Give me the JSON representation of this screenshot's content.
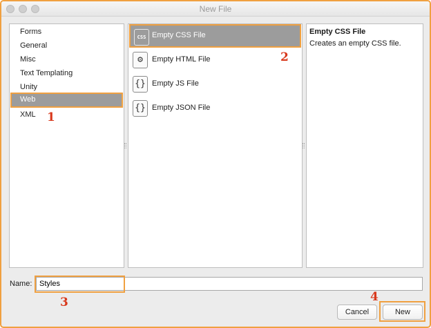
{
  "window": {
    "title": "New File"
  },
  "categories": [
    {
      "label": "Forms",
      "selected": false
    },
    {
      "label": "General",
      "selected": false
    },
    {
      "label": "Misc",
      "selected": false
    },
    {
      "label": "Text Templating",
      "selected": false
    },
    {
      "label": "Unity",
      "selected": false
    },
    {
      "label": "Web",
      "selected": true
    },
    {
      "label": "XML",
      "selected": false
    }
  ],
  "templates": [
    {
      "label": "Empty CSS File",
      "icon": "css-file-icon",
      "icon_text": "CSS",
      "selected": true
    },
    {
      "label": "Empty HTML File",
      "icon": "html-file-icon",
      "icon_text": "⚙",
      "selected": false
    },
    {
      "label": "Empty JS File",
      "icon": "js-file-icon",
      "icon_text": "{}",
      "selected": false
    },
    {
      "label": "Empty JSON File",
      "icon": "json-file-icon",
      "icon_text": "{}",
      "selected": false
    }
  ],
  "description": {
    "title": "Empty CSS File",
    "text": "Creates an empty CSS file."
  },
  "name_field": {
    "label": "Name:",
    "value": "Styles"
  },
  "buttons": {
    "cancel": "Cancel",
    "new": "New"
  },
  "annotations": {
    "step1": "1",
    "step2": "2",
    "step3": "3",
    "step4": "4"
  },
  "colors": {
    "highlight": "#f0a040",
    "selection": "#9c9c9c",
    "annotation": "#d8381c"
  }
}
